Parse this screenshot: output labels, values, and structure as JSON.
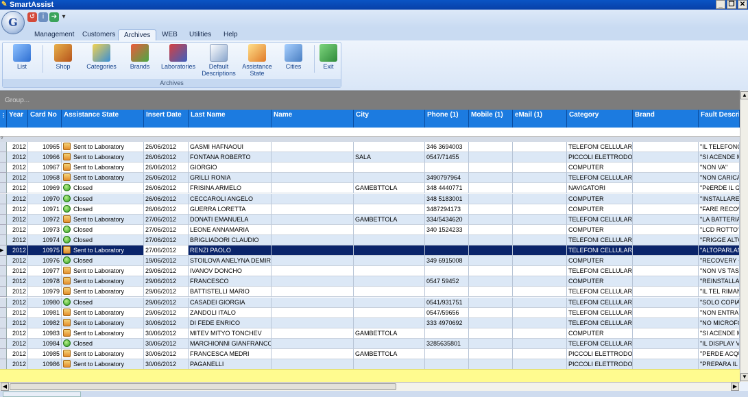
{
  "app": {
    "title": "SmartAssist"
  },
  "window_buttons": [
    "_",
    "❐",
    "✕"
  ],
  "tabs": [
    "Management",
    "Customers",
    "Archives",
    "WEB",
    "Utilities",
    "Help"
  ],
  "active_tab": "Archives",
  "ribbon": {
    "group_label": "Archives",
    "buttons": [
      {
        "label": "List",
        "icon": "list-icon"
      },
      {
        "label": "Shop",
        "icon": "shop-icon"
      },
      {
        "label": "Categories",
        "icon": "categories-icon"
      },
      {
        "label": "Brands",
        "icon": "brands-icon"
      },
      {
        "label": "Laboratories",
        "icon": "laboratories-icon"
      },
      {
        "label": "Default Descriptions",
        "icon": "descriptions-icon"
      },
      {
        "label": "Assistance State",
        "icon": "assistance-state-icon"
      },
      {
        "label": "Cities",
        "icon": "cities-icon"
      },
      {
        "label": "Exit",
        "icon": "exit-icon"
      }
    ]
  },
  "group_bar": "Group...",
  "grid": {
    "columns": [
      "Year",
      "Card No",
      "Assistance State",
      "Insert Date",
      "Last Name",
      "Name",
      "City",
      "Phone (1)",
      "Mobile (1)",
      "eMail (1)",
      "Category",
      "Brand",
      "Fault Descrip"
    ],
    "selected_index": 10,
    "rows": [
      [
        "2012",
        "10965",
        "Sent to Laboratory",
        "26/06/2012",
        "GASMI HAFNAOUI",
        "",
        "",
        "346 3694003",
        "",
        "",
        "TELEFONI CELLULARI",
        "",
        "\"IL TELEFONO"
      ],
      [
        "2012",
        "10966",
        "Sent to Laboratory",
        "26/06/2012",
        "FONTANA ROBERTO",
        "",
        "SALA",
        "0547/71455",
        "",
        "",
        "PICCOLI ELETTRODOM",
        "",
        "\"SI ACENDE M"
      ],
      [
        "2012",
        "10967",
        "Sent to Laboratory",
        "26/06/2012",
        "GIORGIO",
        "",
        "",
        "",
        "",
        "",
        "COMPUTER",
        "",
        "\"NON VA\""
      ],
      [
        "2012",
        "10968",
        "Sent to Laboratory",
        "26/06/2012",
        "GRILLI RONIA",
        "",
        "",
        "3490797964",
        "",
        "",
        "TELEFONI CELLULARI",
        "",
        "\"NON CARICA"
      ],
      [
        "2012",
        "10969",
        "Closed",
        "26/06/2012",
        "FRISINA ARMELO",
        "",
        "GAMEBTTOLA",
        "348 4440771",
        "",
        "",
        "NAVIGATORI",
        "",
        "\"PèERDE IL G"
      ],
      [
        "2012",
        "10970",
        "Closed",
        "26/06/2012",
        "CECCAROLI ANGELO",
        "",
        "",
        "348 5183001",
        "",
        "",
        "COMPUTER",
        "",
        "\"INSTALLARE"
      ],
      [
        "2012",
        "10971",
        "Closed",
        "26/06/2012",
        "GUERRA LORETTA",
        "",
        "",
        "3487294173",
        "",
        "",
        "COMPUTER",
        "",
        "\"FARE RECOV"
      ],
      [
        "2012",
        "10972",
        "Sent to Laboratory",
        "27/06/2012",
        "DONATI EMANUELA",
        "",
        "GAMBETTOLA",
        "334/5434620",
        "",
        "",
        "TELEFONI CELLULARI",
        "",
        "\"LA BATTERIA"
      ],
      [
        "2012",
        "10973",
        "Closed",
        "27/06/2012",
        "LEONE ANNAMARIA",
        "",
        "",
        "340 1524233",
        "",
        "",
        "COMPUTER",
        "",
        "\"LCD ROTTO\""
      ],
      [
        "2012",
        "10974",
        "Closed",
        "27/06/2012",
        "BRIGLIADORI CLAUDIO",
        "",
        "",
        "",
        "",
        "",
        "TELEFONI CELLULARI",
        "",
        "\"FRIGGE ALTO"
      ],
      [
        "2012",
        "10975",
        "Sent to Laboratory",
        "27/06/2012",
        "RENZI PAOLO",
        "",
        "",
        "",
        "",
        "",
        "TELEFONI CELLULARI",
        "",
        "\"ALTOPARLAN"
      ],
      [
        "2012",
        "10976",
        "Closed",
        "19/06/2012",
        "STOILOVA ANELYNA DEMIR",
        "",
        "",
        "349 6915008",
        "",
        "",
        "COMPUTER",
        "",
        "\"RECOVERY +"
      ],
      [
        "2012",
        "10977",
        "Sent to Laboratory",
        "29/06/2012",
        "IVANOV DONCHO",
        "",
        "",
        "",
        "",
        "",
        "TELEFONI CELLULARI",
        "",
        "\"NON VS TAS"
      ],
      [
        "2012",
        "10978",
        "Sent to Laboratory",
        "29/06/2012",
        "FRANCESCO",
        "",
        "",
        "0547 59452",
        "",
        "",
        "COMPUTER",
        "",
        "\"REINSTALLA"
      ],
      [
        "2012",
        "10979",
        "Sent to Laboratory",
        "29/06/2012",
        "BATTISTELLI MARIO",
        "",
        "",
        "",
        "",
        "",
        "TELEFONI CELLULARI",
        "",
        "\"IL TEL RIMAN"
      ],
      [
        "2012",
        "10980",
        "Closed",
        "29/06/2012",
        "CASADEI GIORGIA",
        "",
        "",
        "0541/931751",
        "",
        "",
        "TELEFONI CELLULARI",
        "",
        "\"SOLO COPIAI"
      ],
      [
        "2012",
        "10981",
        "Sent to Laboratory",
        "29/06/2012",
        "ZANDOLI ITALO",
        "",
        "",
        "0547/59656",
        "",
        "",
        "TELEFONI CELLULARI",
        "",
        "\"NON ENTRA"
      ],
      [
        "2012",
        "10982",
        "Sent to Laboratory",
        "30/06/2012",
        "DI FEDE ENRICO",
        "",
        "",
        "333 4970692",
        "",
        "",
        "TELEFONI CELLULARI",
        "",
        "\"NO MICROFO"
      ],
      [
        "2012",
        "10983",
        "Sent to Laboratory",
        "30/06/2012",
        "MITEV MITYO TONCHEV",
        "",
        "GAMBETTOLA",
        "",
        "",
        "",
        "COMPUTER",
        "",
        "\"SI ACENDE M"
      ],
      [
        "2012",
        "10984",
        "Closed",
        "30/06/2012",
        "MARCHIONNI GIANFRANCO",
        "",
        "",
        "3285635801",
        "",
        "",
        "TELEFONI CELLULARI",
        "",
        "\"IL DISPLAY V"
      ],
      [
        "2012",
        "10985",
        "Sent to Laboratory",
        "30/06/2012",
        "FRANCESCA MEDRI",
        "",
        "GAMBETTOLA",
        "",
        "",
        "",
        "PICCOLI ELETTRODOM",
        "",
        "\"PERDE ACQU"
      ],
      [
        "2012",
        "10986",
        "Sent to Laboratory",
        "30/06/2012",
        "PAGANELLI",
        "",
        "",
        "",
        "",
        "",
        "PICCOLI ELETTRODOM",
        "",
        "\"PREPARA IL"
      ]
    ]
  },
  "colors": {
    "header": "#1c7be0",
    "selected_row": "#0a246a",
    "row_alt": "#dce8f6",
    "yellow_bar": "#fffb8f"
  }
}
